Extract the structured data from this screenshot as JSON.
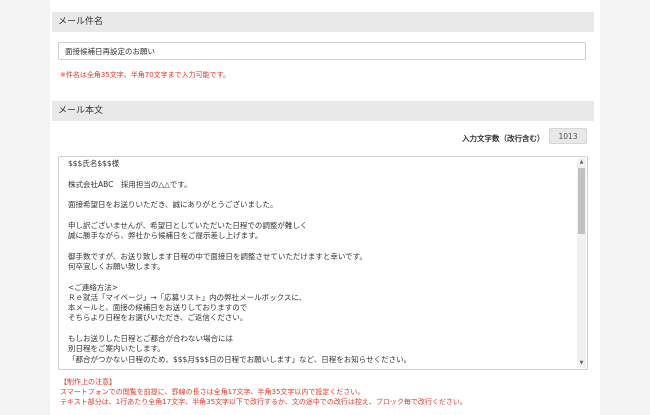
{
  "subject": {
    "header": "メール件名",
    "value": "面接候補日再設定のお願い",
    "note": "※件名は全角35文字、半角70文字まで入力可能です。"
  },
  "body": {
    "header": "メール本文",
    "count_label": "入力文字数（改行含む）",
    "count_value": "1013",
    "lines": [
      "$$$氏名$$$様",
      "",
      "株式会社ABC　採用担当の△△です。",
      "",
      "面接希望日をお送りいただき、誠にありがとうございました。",
      "",
      "申し訳ございませんが、希望日としていただいた日程での調整が難しく",
      "誠に勝手ながら、弊社から候補日をご提示差し上げます。",
      "",
      "御手数ですが、お送り致します日程の中で面接日を調整させていただけますと幸いです。",
      "何卒宜しくお願い致します。",
      "",
      "<ご連絡方法>",
      "Ｒｅ就活「マイページ」→「応募リスト」内の弊社メールボックスに、",
      "本メールと、面接の候補日をお送りしておりますので",
      "そちらより日程をお選びいただき、ご返信ください。",
      "",
      "もしお送りした日程とご都合が合わない場合には",
      "別日程をご案内いたします。",
      "「都合がつかない日程のため、$$$月$$$日の日程でお願いします」など、日程をお知らせください。"
    ]
  },
  "footer": {
    "lines": [
      "【制作上の注意】",
      "スマートフォンでの閲覧を前提に、罫線の長さは全角17文字、半角35文字以内で設定ください。",
      "テキスト部分は、1行あたり全角17文字、半角35文字以下で改行するか、文の途中での改行は控え、ブロック毎で改行ください。"
    ]
  },
  "icons": {
    "scroll_up": "triangle-up-icon",
    "scroll_down": "triangle-down-icon"
  },
  "colors": {
    "accent_red": "#e0382b",
    "section_bg": "#e9e9e9"
  }
}
